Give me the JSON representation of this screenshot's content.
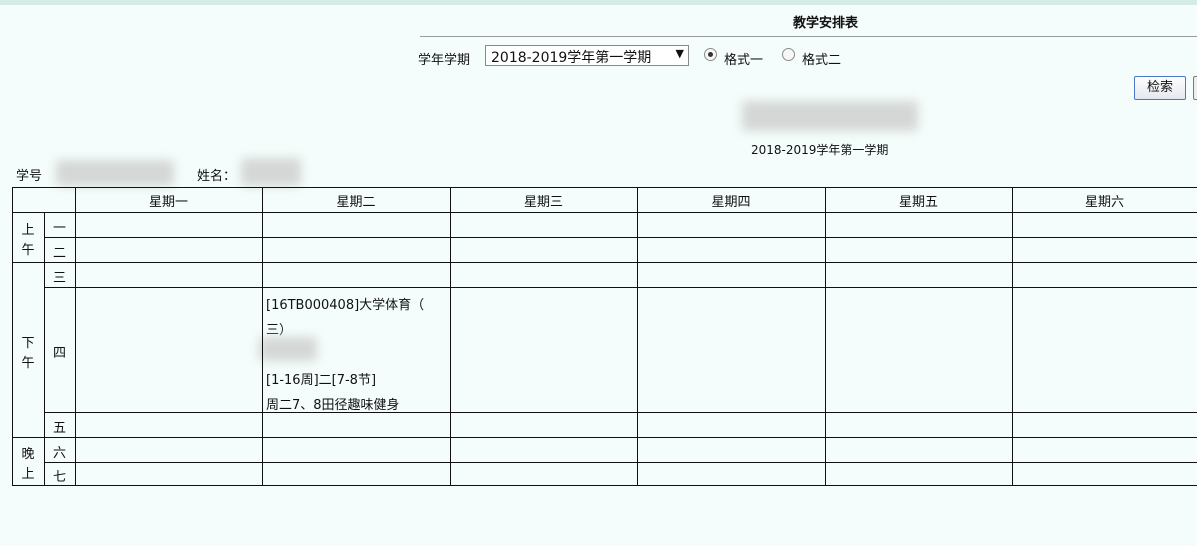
{
  "page": {
    "title": "教学安排表"
  },
  "filters": {
    "term_label": "学年学期",
    "term_value": "2018-2019学年第一学期",
    "format_options": [
      {
        "label": "格式一",
        "checked": true
      },
      {
        "label": "格式二",
        "checked": false
      }
    ],
    "search_label": "检索"
  },
  "timetable": {
    "subtitle": "2018-2019学年第一学期",
    "student_id_label": "学号",
    "name_label": "姓名：",
    "days": [
      "星期一",
      "星期二",
      "星期三",
      "星期四",
      "星期五",
      "星期六"
    ],
    "periods": [
      {
        "group": "上午",
        "items": [
          "一",
          "二"
        ]
      },
      {
        "group": "下午",
        "items": [
          "三",
          "四",
          "五"
        ]
      },
      {
        "group": "晚上",
        "items": [
          "六",
          "七"
        ]
      }
    ],
    "course": {
      "day": "星期二",
      "period": "四",
      "lines": [
        "[16TB000408]大学体育（",
        "三）",
        "[1-16周]二[7-8节]",
        "周二7、8田径趣味健身"
      ]
    }
  },
  "colors": {
    "background": "#f4fdfb",
    "button_border": "#4b78c8",
    "grid": "#111111"
  }
}
